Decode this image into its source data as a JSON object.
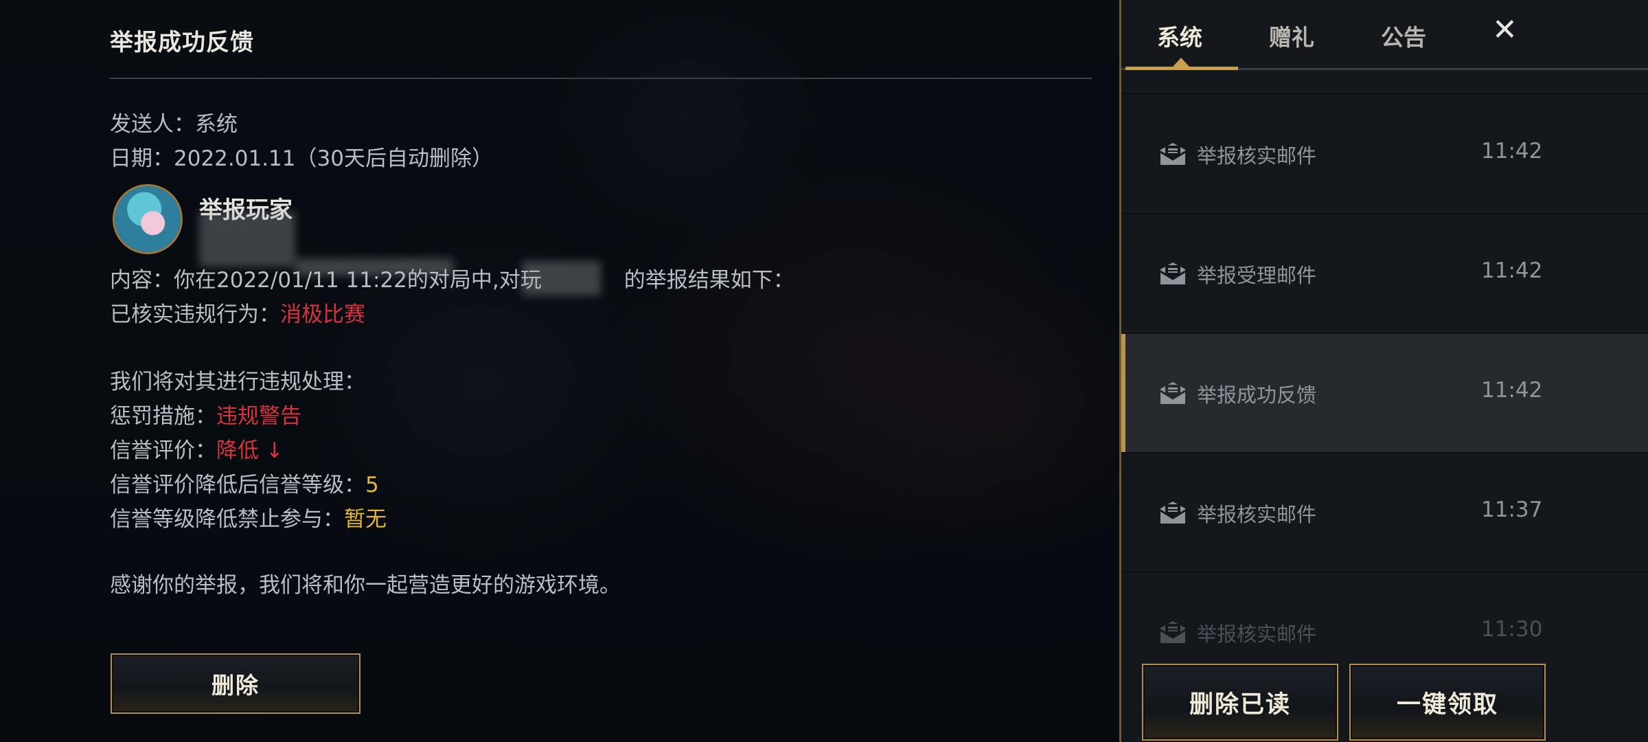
{
  "detail": {
    "title": "举报成功反馈",
    "sender_label": "发送人：",
    "sender": "系统",
    "date_label": "日期：",
    "date": "2022.01.11（30天后自动删除）",
    "player_name": "举报玩家",
    "content_prefix": "内容：你在2022/01/11 11:22的对局中,对玩",
    "content_suffix": "的举报结果如下：",
    "verified_label": "已核实违规行为：",
    "verified_value": "消极比赛",
    "process_line": "我们将对其进行违规处理：",
    "penalty_label": "惩罚措施：",
    "penalty_value": "违规警告",
    "credit_label": "信誉评价：",
    "credit_value": "降低 ↓",
    "credit_level_label": "信誉评价降低后信誉等级：",
    "credit_level_value": "5",
    "ban_label": "信誉等级降低禁止参与：",
    "ban_value": "暂无",
    "thanks": "感谢你的举报，我们将和你一起营造更好的游戏环境。",
    "delete_button": "删除"
  },
  "panel": {
    "tabs": [
      {
        "label": "系统",
        "active": true
      },
      {
        "label": "赠礼",
        "active": false
      },
      {
        "label": "公告",
        "active": false
      }
    ],
    "close_label": "✕",
    "mails": [
      {
        "title": "举报核实邮件",
        "time": "11:42"
      },
      {
        "title": "举报受理邮件",
        "time": "11:42"
      },
      {
        "title": "举报成功反馈",
        "time": "11:42",
        "selected": true
      },
      {
        "title": "举报核实邮件",
        "time": "11:37"
      },
      {
        "title": "举报核实邮件",
        "time": "11:30"
      }
    ],
    "delete_read_button": "删除已读",
    "claim_all_button": "一键领取"
  },
  "colors": {
    "accent_gold": "#c8a050",
    "warning_red": "#d8323e",
    "value_gold": "#e3b72f",
    "mail_icon": "mail-read-icon"
  }
}
